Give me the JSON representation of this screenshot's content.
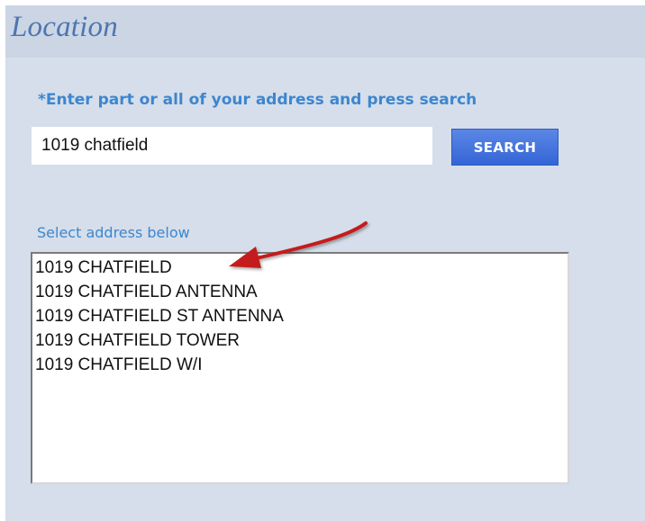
{
  "panel": {
    "title": "Location"
  },
  "search": {
    "instructions": "*Enter part or all of your address and press search",
    "input_value": "1019 chatfield",
    "button_label": "SEARCH"
  },
  "results": {
    "label": "Select address below",
    "items": [
      "1019 CHATFIELD",
      "1019 CHATFIELD ANTENNA",
      "1019 CHATFIELD ST ANTENNA",
      "1019 CHATFIELD TOWER",
      "1019 CHATFIELD W/I"
    ]
  },
  "annotation": {
    "icon": "red-arrow-icon",
    "color": "#c41e1e"
  },
  "colors": {
    "panel_background": "#d5deea",
    "header_background": "#cbd5e4",
    "title": "#4d76b0",
    "label": "#3d86cf",
    "button": "#3565d6"
  }
}
